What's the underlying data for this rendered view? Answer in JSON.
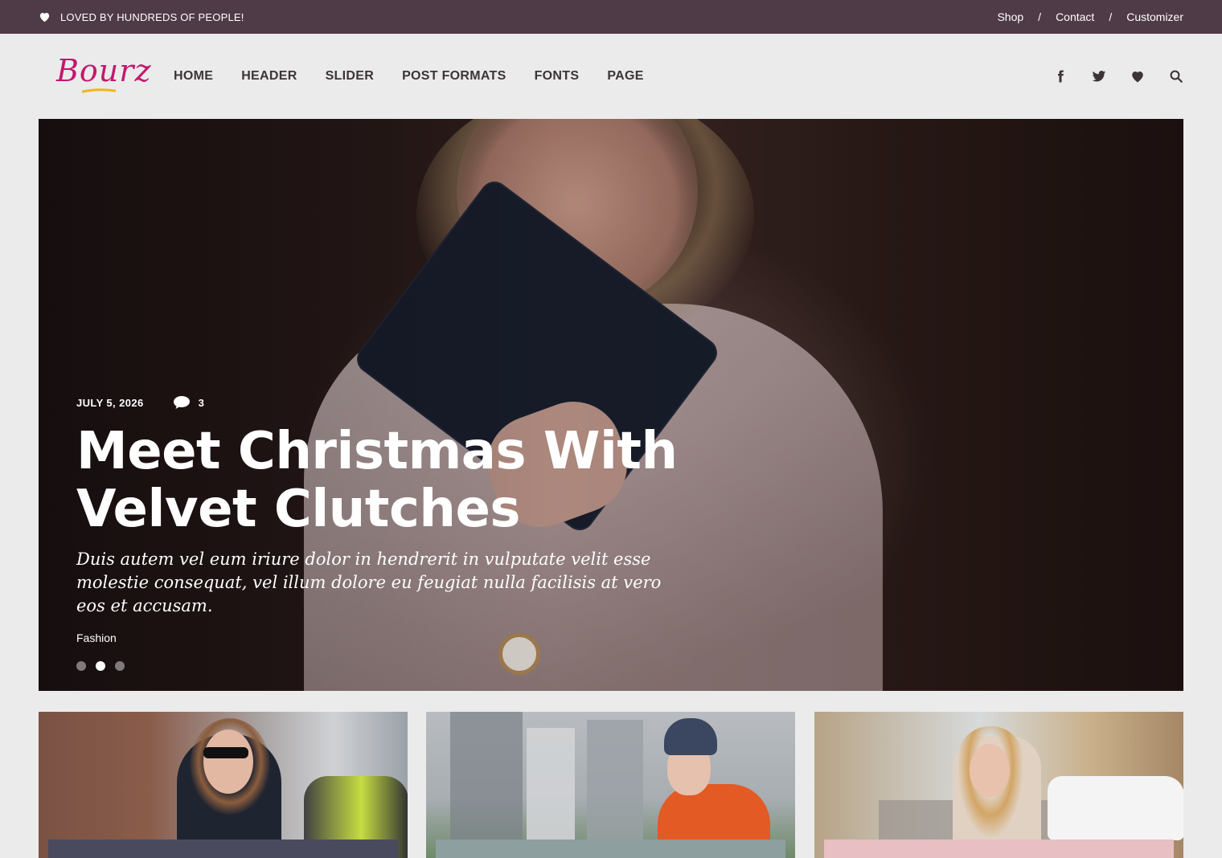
{
  "topbar": {
    "tagline": "LOVED BY HUNDREDS OF PEOPLE!",
    "links": [
      "Shop",
      "Contact",
      "Customizer"
    ],
    "separator": "/"
  },
  "header": {
    "logo_text": "Bourz",
    "nav": [
      "HOME",
      "HEADER",
      "SLIDER",
      "POST FORMATS",
      "FONTS",
      "PAGE"
    ],
    "icons": [
      "facebook-icon",
      "twitter-icon",
      "heart-icon",
      "search-icon"
    ]
  },
  "hero": {
    "date": "JULY 5, 2026",
    "comment_count": "3",
    "title": "Meet Christmas With Velvet Clutches",
    "excerpt": "Duis autem vel eum iriure dolor in hendrerit in vulputate velit esse molestie consequat, vel illum dolore eu feugiat nulla facilisis at vero eos et accusam.",
    "category": "Fashion",
    "slides_total": 3,
    "active_slide": 2
  },
  "cards": [
    {
      "strip_color": "#4a4a5e"
    },
    {
      "strip_color": "#8e9fa0"
    },
    {
      "strip_color": "#e8bfc3"
    }
  ],
  "colors": {
    "topbar_bg": "#4f3a47",
    "page_bg": "#ebebeb",
    "logo": "#c2186c",
    "logo_underline": "#f2b51c",
    "nav_text": "#3d3438"
  }
}
